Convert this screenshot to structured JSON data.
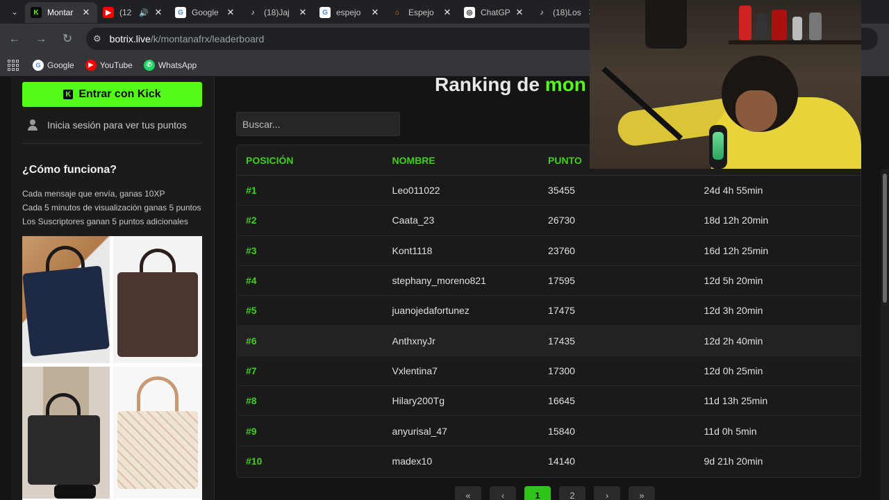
{
  "browser": {
    "tabs": [
      {
        "title": "Montar",
        "fav_color": "#0a0a0a",
        "fav_text": "K",
        "fav_fg": "#53fc18"
      },
      {
        "title": "(12",
        "fav_color": "#ff0000",
        "fav_text": "▶",
        "fav_fg": "#ffffff",
        "audio": "🔊"
      },
      {
        "title": "Google",
        "fav_color": "#ffffff",
        "fav_text": "G",
        "fav_fg": "#4285f4"
      },
      {
        "title": "(18)Jaj",
        "fav_color": "#202124",
        "fav_text": "♪",
        "fav_fg": "#ffffff"
      },
      {
        "title": "espejo",
        "fav_color": "#ffffff",
        "fav_text": "G",
        "fav_fg": "#4285f4"
      },
      {
        "title": "Espejo",
        "fav_color": "#202124",
        "fav_text": "⌂",
        "fav_fg": "#f57c00"
      },
      {
        "title": "ChatGP",
        "fav_color": "#ffffff",
        "fav_text": "◎",
        "fav_fg": "#202124"
      },
      {
        "title": "(18)Los",
        "fav_color": "#202124",
        "fav_text": "♪",
        "fav_fg": "#ffffff"
      }
    ],
    "url_host": "botrix.live",
    "url_path": "/k/montanafrx/leaderboard",
    "bookmarks": [
      {
        "label": "Google",
        "icon": "G",
        "color": "#ffffff",
        "fg": "#4285f4"
      },
      {
        "label": "YouTube",
        "icon": "▶",
        "color": "#ff0000",
        "fg": "#ffffff"
      },
      {
        "label": "WhatsApp",
        "icon": "✆",
        "color": "#25d366",
        "fg": "#ffffff"
      }
    ]
  },
  "sidebar": {
    "kick_button": "Entrar con Kick",
    "login_hint": "Inicia sesión para ver tus puntos",
    "how_title": "¿Cómo funciona?",
    "how_lines": [
      "Cada mensaje que envía, ganas 10XP",
      "Cada 5 minutos de visualización ganas 5 puntos",
      "Los Suscriptores ganan 5 puntos adicionales"
    ]
  },
  "main": {
    "heading_prefix": "Ranking de ",
    "heading_channel": "mon",
    "search_placeholder": "Buscar...",
    "columns": [
      "POSICIÓN",
      "NOMBRE",
      "PUNTO"
    ],
    "rows": [
      {
        "pos": "#1",
        "name": "Leo011022",
        "points": "35455",
        "time": "24d 4h 55min"
      },
      {
        "pos": "#2",
        "name": "Caata_23",
        "points": "26730",
        "time": "18d 12h 20min"
      },
      {
        "pos": "#3",
        "name": "Kont1118",
        "points": "23760",
        "time": "16d 12h 25min"
      },
      {
        "pos": "#4",
        "name": "stephany_moreno821",
        "points": "17595",
        "time": "12d 5h 20min"
      },
      {
        "pos": "#5",
        "name": "juanojedafortunez",
        "points": "17475",
        "time": "12d 3h 20min"
      },
      {
        "pos": "#6",
        "name": "AnthxnyJr",
        "points": "17435",
        "time": "12d 2h 40min"
      },
      {
        "pos": "#7",
        "name": "Vxlentina7",
        "points": "17300",
        "time": "12d 0h 25min"
      },
      {
        "pos": "#8",
        "name": "Hilary200Tg",
        "points": "16645",
        "time": "11d 13h 25min"
      },
      {
        "pos": "#9",
        "name": "anyurisal_47",
        "points": "15840",
        "time": "11d 0h 5min"
      },
      {
        "pos": "#10",
        "name": "madex10",
        "points": "14140",
        "time": "9d 21h 20min"
      }
    ],
    "pager": [
      "«",
      "‹",
      "1",
      "2",
      "›",
      "»"
    ],
    "accent_color": "#53fc18"
  }
}
